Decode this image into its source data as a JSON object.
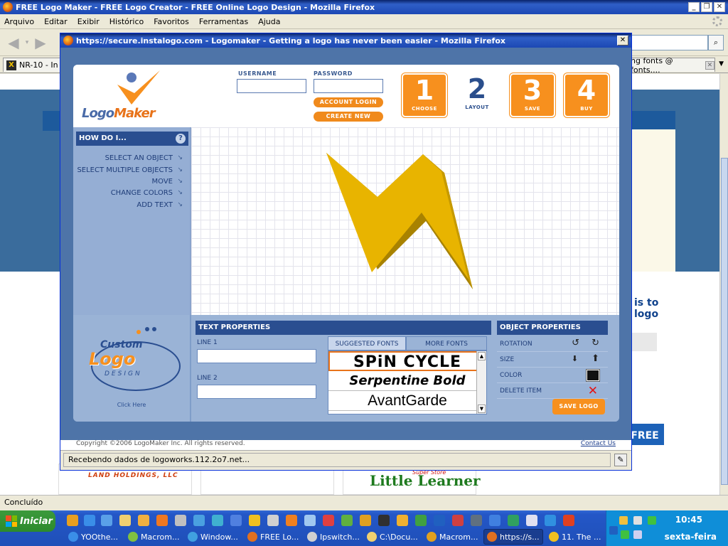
{
  "browser": {
    "title": "FREE Logo Maker - FREE Logo Creator - FREE Online Logo Design - Mozilla Firefox",
    "menu": [
      "Arquivo",
      "Editar",
      "Exibir",
      "Histórico",
      "Favoritos",
      "Ferramentas",
      "Ajuda"
    ],
    "tab_left": "NR-10 - In",
    "tab_right": "ng fonts @ fonts....",
    "status": "Concluído"
  },
  "background_page": {
    "side_text_1": "is to",
    "side_text_2": "logo",
    "free_button": "FREE",
    "land_holdings": "LAND HOLDINGS, LLC",
    "little_learner": "Little Learner",
    "super_store": "Super Store"
  },
  "popup": {
    "title": "https://secure.instalogo.com - Logomaker - Getting a logo has never been easier - Mozilla Firefox",
    "status": "Recebendo dados de logoworks.112.2o7.net...",
    "footer_copyright": "Copyright ©2006 LogoMaker Inc. All rights reserved.",
    "footer_contact": "Contact Us"
  },
  "app": {
    "logo_text_a": "Logo",
    "logo_text_b": "Maker",
    "username_label": "USERNAME",
    "password_label": "PASSWORD",
    "login_button": "ACCOUNT LOGIN",
    "create_button": "CREATE NEW ACCOUNT",
    "steps": [
      {
        "num": "1",
        "label": "CHOOSE"
      },
      {
        "num": "2",
        "label": "LAYOUT"
      },
      {
        "num": "3",
        "label": "SAVE"
      },
      {
        "num": "4",
        "label": "BUY"
      }
    ],
    "howdo_title": "HOW DO I...",
    "howdo_help": "?",
    "help_items": [
      "SELECT AN OBJECT",
      "SELECT MULTIPLE OBJECTS",
      "MOVE",
      "CHANGE COLORS",
      "ADD TEXT"
    ],
    "custom_logo_1": "Custom",
    "custom_logo_2": "Logo",
    "custom_logo_3": "DESIGN",
    "click_here": "Click Here",
    "text_properties": "TEXT PROPERTIES",
    "line1_label": "LINE 1",
    "line2_label": "LINE 2",
    "line1_value": "",
    "line2_value": "",
    "suggested_fonts": "SUGGESTED FONTS",
    "more_fonts": "MORE FONTS",
    "fonts": [
      "SPiN CYCLE",
      "Serpentine Bold",
      "AvantGarde"
    ],
    "object_properties": "OBJECT PROPERTIES",
    "rotation": "ROTATION",
    "size": "SIZE",
    "color": "COLOR",
    "delete_item": "DELETE ITEM",
    "save_logo": "SAVE LOGO",
    "object_color": "#111111",
    "bolt_color": "#e8b400"
  },
  "taskbar": {
    "start": "Iniciar",
    "items": [
      "YOOthe...",
      "Macrom...",
      "Window...",
      "FREE Lo...",
      "Ipswitch...",
      "C:\\Docu...",
      "Macrom...",
      "https://s...",
      "11. The ..."
    ],
    "time": "10:45",
    "day": "sexta-feira"
  }
}
